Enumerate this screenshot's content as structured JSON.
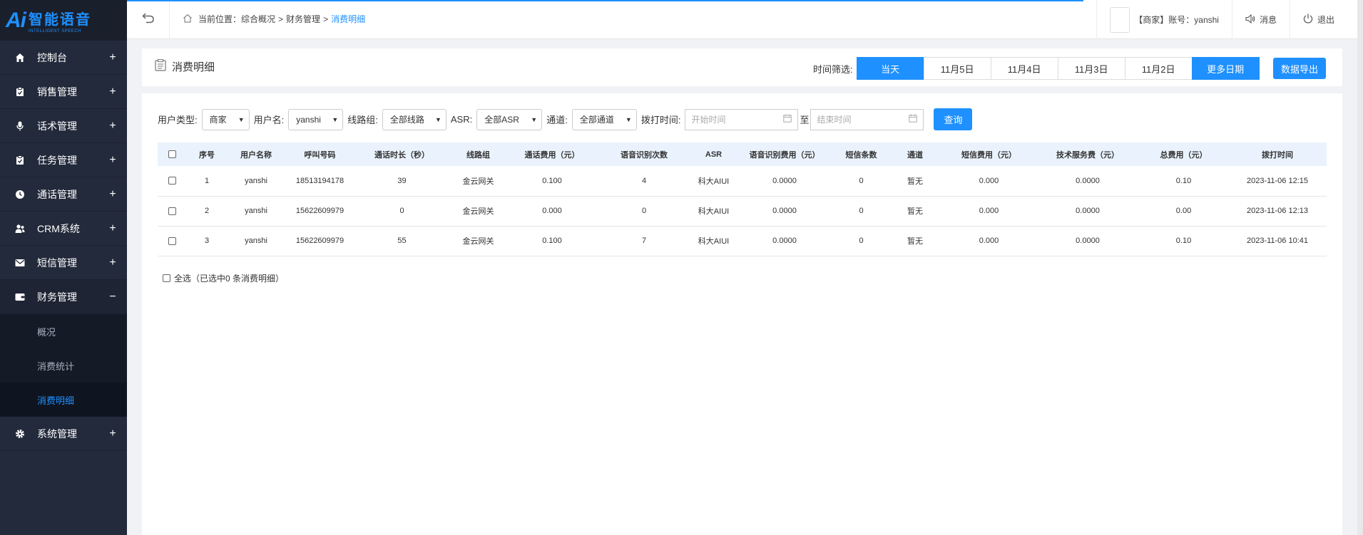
{
  "app": {
    "logo_ai": "Ai",
    "logo_cn": "智能语音",
    "logo_en": "INTELLIGENT SPEECH"
  },
  "sidebar": {
    "items": [
      {
        "label": "控制台",
        "icon": "home-icon",
        "toggle": "+"
      },
      {
        "label": "销售管理",
        "icon": "clipboard-icon",
        "toggle": "+"
      },
      {
        "label": "话术管理",
        "icon": "microphone-icon",
        "toggle": "+"
      },
      {
        "label": "任务管理",
        "icon": "clipboard-check-icon",
        "toggle": "+"
      },
      {
        "label": "通话管理",
        "icon": "clock-icon",
        "toggle": "+"
      },
      {
        "label": "CRM系统",
        "icon": "users-icon",
        "toggle": "+"
      },
      {
        "label": "短信管理",
        "icon": "envelope-icon",
        "toggle": "+"
      },
      {
        "label": "财务管理",
        "icon": "wallet-icon",
        "toggle": "−"
      }
    ],
    "submenu": [
      {
        "label": "概况"
      },
      {
        "label": "消费统计"
      },
      {
        "label": "消费明细"
      }
    ],
    "last_item": {
      "label": "系统管理",
      "icon": "gear-icon",
      "toggle": "+"
    }
  },
  "topbar": {
    "back_icon": "undo-icon",
    "breadcrumb": {
      "prefix": "当前位置：",
      "level1": "综合概况",
      "level2": "财务管理",
      "current": "消费明细",
      "sep": ">"
    },
    "account": "【商家】账号：yanshi",
    "messages": "消息",
    "logout": "退出"
  },
  "header": {
    "title": "消费明细",
    "time_filter_label": "时间筛选:",
    "time_buttons": [
      "当天",
      "11月5日",
      "11月4日",
      "11月3日",
      "11月2日",
      "更多日期"
    ],
    "export_label": "数据导出"
  },
  "filters": {
    "user_type_label": "用户类型:",
    "user_type_value": "商家",
    "username_label": "用户名:",
    "username_value": "yanshi",
    "line_group_label": "线路组:",
    "line_group_value": "全部线路",
    "asr_label": "ASR:",
    "asr_value": "全部ASR",
    "channel_label": "通道:",
    "channel_value": "全部通道",
    "dial_time_label": "拨打时间:",
    "start_placeholder": "开始时间",
    "to_label": "至",
    "end_placeholder": "结束时间",
    "query_label": "查询"
  },
  "table": {
    "columns": [
      "序号",
      "用户名称",
      "呼叫号码",
      "通话时长（秒）",
      "线路组",
      "通话费用（元）",
      "语音识别次数",
      "ASR",
      "语音识别费用（元）",
      "短信条数",
      "通道",
      "短信费用（元）",
      "技术服务费（元）",
      "总费用（元）",
      "拨打时间"
    ],
    "rows": [
      [
        "1",
        "yanshi",
        "18513194178",
        "39",
        "金云网关",
        "0.100",
        "4",
        "科大AIUI",
        "0.0000",
        "0",
        "暂无",
        "0.000",
        "0.0000",
        "0.10",
        "2023-11-06 12:15"
      ],
      [
        "2",
        "yanshi",
        "15622609979",
        "0",
        "金云网关",
        "0.000",
        "0",
        "科大AIUI",
        "0.0000",
        "0",
        "暂无",
        "0.000",
        "0.0000",
        "0.00",
        "2023-11-06 12:13"
      ],
      [
        "3",
        "yanshi",
        "15622609979",
        "55",
        "金云网关",
        "0.100",
        "7",
        "科大AIUI",
        "0.0000",
        "0",
        "暂无",
        "0.000",
        "0.0000",
        "0.10",
        "2023-11-06 10:41"
      ]
    ]
  },
  "footer": {
    "select_all": "全选（已选中0 条消费明细）"
  },
  "colors": {
    "accent": "#1e90ff",
    "sidebar_bg": "#232a3b"
  }
}
